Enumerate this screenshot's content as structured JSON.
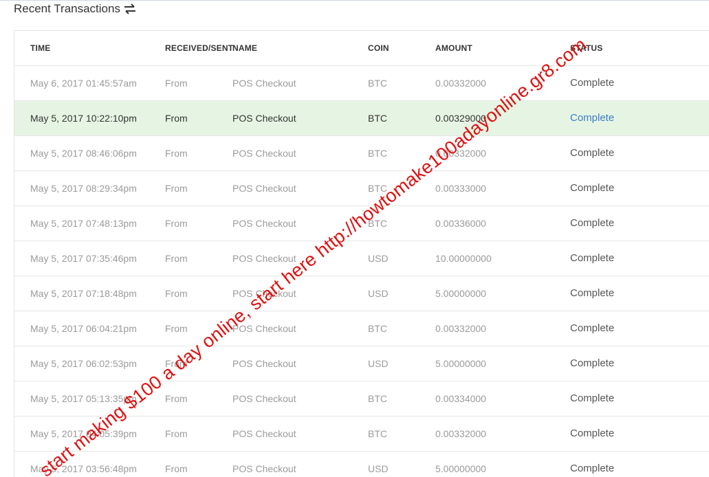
{
  "section": {
    "title": "Recent Transactions",
    "icon": "swap-arrows-icon"
  },
  "table": {
    "headers": {
      "time": "TIME",
      "direction": "RECEIVED/SENT",
      "name": "NAME",
      "coin": "COIN",
      "amount": "AMOUNT",
      "status": "STATUS"
    },
    "rows": [
      {
        "time": "May 6, 2017 01:45:57am",
        "direction": "From",
        "name": "POS Checkout",
        "coin": "BTC",
        "amount": "0.00332000",
        "status": "Complete"
      },
      {
        "time": "May 5, 2017 10:22:10pm",
        "direction": "From",
        "name": "POS Checkout",
        "coin": "BTC",
        "amount": "0.00329000",
        "status": "Complete"
      },
      {
        "time": "May 5, 2017 08:46:06pm",
        "direction": "From",
        "name": "POS Checkout",
        "coin": "BTC",
        "amount": "0.00332000",
        "status": "Complete"
      },
      {
        "time": "May 5, 2017 08:29:34pm",
        "direction": "From",
        "name": "POS Checkout",
        "coin": "BTC",
        "amount": "0.00333000",
        "status": "Complete"
      },
      {
        "time": "May 5, 2017 07:48:13pm",
        "direction": "From",
        "name": "POS Checkout",
        "coin": "BTC",
        "amount": "0.00336000",
        "status": "Complete"
      },
      {
        "time": "May 5, 2017 07:35:46pm",
        "direction": "From",
        "name": "POS Checkout",
        "coin": "USD",
        "amount": "10.00000000",
        "status": "Complete"
      },
      {
        "time": "May 5, 2017 07:18:48pm",
        "direction": "From",
        "name": "POS Checkout",
        "coin": "USD",
        "amount": "5.00000000",
        "status": "Complete"
      },
      {
        "time": "May 5, 2017 06:04:21pm",
        "direction": "From",
        "name": "POS Checkout",
        "coin": "BTC",
        "amount": "0.00332000",
        "status": "Complete"
      },
      {
        "time": "May 5, 2017 06:02:53pm",
        "direction": "From",
        "name": "POS Checkout",
        "coin": "USD",
        "amount": "5.00000000",
        "status": "Complete"
      },
      {
        "time": "May 5, 2017 05:13:35pm",
        "direction": "From",
        "name": "POS Checkout",
        "coin": "BTC",
        "amount": "0.00334000",
        "status": "Complete"
      },
      {
        "time": "May 5, 2017 04:05:39pm",
        "direction": "From",
        "name": "POS Checkout",
        "coin": "BTC",
        "amount": "0.00332000",
        "status": "Complete"
      },
      {
        "time": "May 5, 2017 03:56:48pm",
        "direction": "From",
        "name": "POS Checkout",
        "coin": "USD",
        "amount": "5.00000000",
        "status": "Complete"
      }
    ]
  },
  "watermark": {
    "text": "start making $100 a day online, start here http://howtomake100adayonline.gr8.com",
    "color": "#e01010"
  },
  "colors": {
    "highlight_row": "#e6f5e3",
    "status_link": "#3a7bc8"
  }
}
